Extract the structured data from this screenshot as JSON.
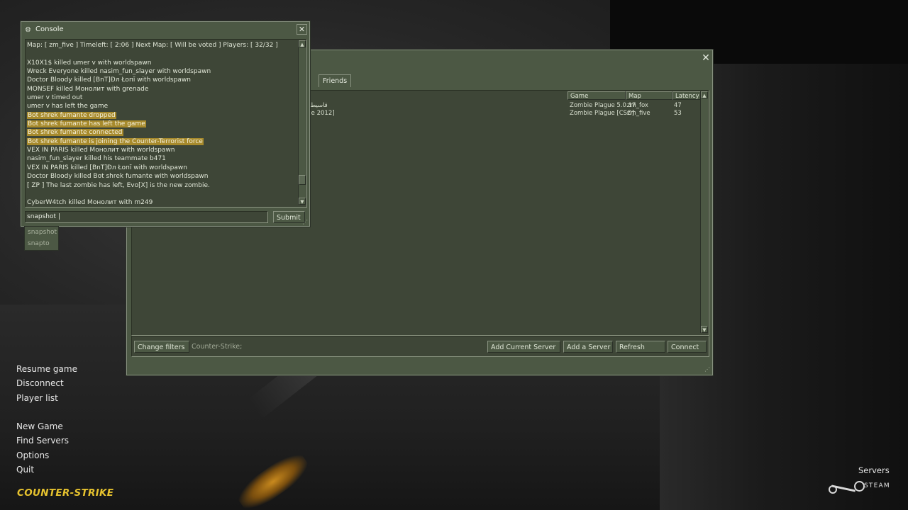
{
  "console": {
    "title": "Console",
    "lines": [
      {
        "text": "Map: [ zm_five ] Timeleft: [ 2:06 ] Next Map: [ Will be voted ] Players: [ 32/32 ]",
        "highlight": false
      },
      {
        "text": "",
        "highlight": false
      },
      {
        "text": "X10X1$ killed umer v with worldspawn",
        "highlight": false
      },
      {
        "text": "Wreck Everyone killed nasim_fun_slayer with worldspawn",
        "highlight": false
      },
      {
        "text": "Doctor Bloody killed [BnT]Đл Łопĭ with worldspawn",
        "highlight": false
      },
      {
        "text": "MONSEF killed Монолит with grenade",
        "highlight": false
      },
      {
        "text": "umer v timed out",
        "highlight": false
      },
      {
        "text": "umer v has left the game",
        "highlight": false
      },
      {
        "text": "Bot shrek fumante dropped",
        "highlight": true
      },
      {
        "text": "Bot shrek fumante has left the game",
        "highlight": true
      },
      {
        "text": "Bot shrek fumante connected",
        "highlight": true
      },
      {
        "text": "Bot shrek fumante is joining the Counter-Terrorist force",
        "highlight": true
      },
      {
        "text": "VEX IN PARIS killed Монолит with worldspawn",
        "highlight": false
      },
      {
        "text": "nasim_fun_slayer killed his teammate b471",
        "highlight": false
      },
      {
        "text": "VEX IN PARIS killed [BnT]Đл Łопĭ with worldspawn",
        "highlight": false
      },
      {
        "text": "Doctor Bloody killed Bot shrek fumante with worldspawn",
        "highlight": false
      },
      {
        "text": "[ ZP ] The last zombie has left, Evo[X] is the new zombie.",
        "highlight": false
      },
      {
        "text": "",
        "highlight": false
      },
      {
        "text": "CyberW4tch killed Монолит with m249",
        "highlight": false
      }
    ],
    "command_value": "snapshot |",
    "submit_label": "Submit",
    "autocomplete": [
      "snapshot",
      "snapto"
    ]
  },
  "browser": {
    "tab_friends": "Friends",
    "columns": {
      "game": "Game",
      "map": "Map",
      "latency": "Latency"
    },
    "servers": [
      {
        "name": "[قاسيط",
        "game": "Zombie Plague 5.0.17",
        "map": "zm_fox",
        "latency": "47"
      },
      {
        "name": "ce 2012]",
        "game": "Zombie Plague [CSO]",
        "map": "zm_five",
        "latency": "53"
      }
    ],
    "change_filters": "Change filters",
    "filter_text": "Counter-Strike;",
    "add_current_server": "Add Current Server",
    "add_server": "Add a Server",
    "refresh": "Refresh",
    "connect": "Connect"
  },
  "menu": {
    "group1": [
      "Resume game",
      "Disconnect",
      "Player list"
    ],
    "group2": [
      "New Game",
      "Find Servers",
      "Options",
      "Quit"
    ]
  },
  "logo": "COUNTER-STRIKE",
  "servers_label": "Servers",
  "steam_word": "STEAM",
  "colors": {
    "panel": "#4c5844",
    "highlight": "#a78a2c",
    "logo": "#e6c22e"
  }
}
